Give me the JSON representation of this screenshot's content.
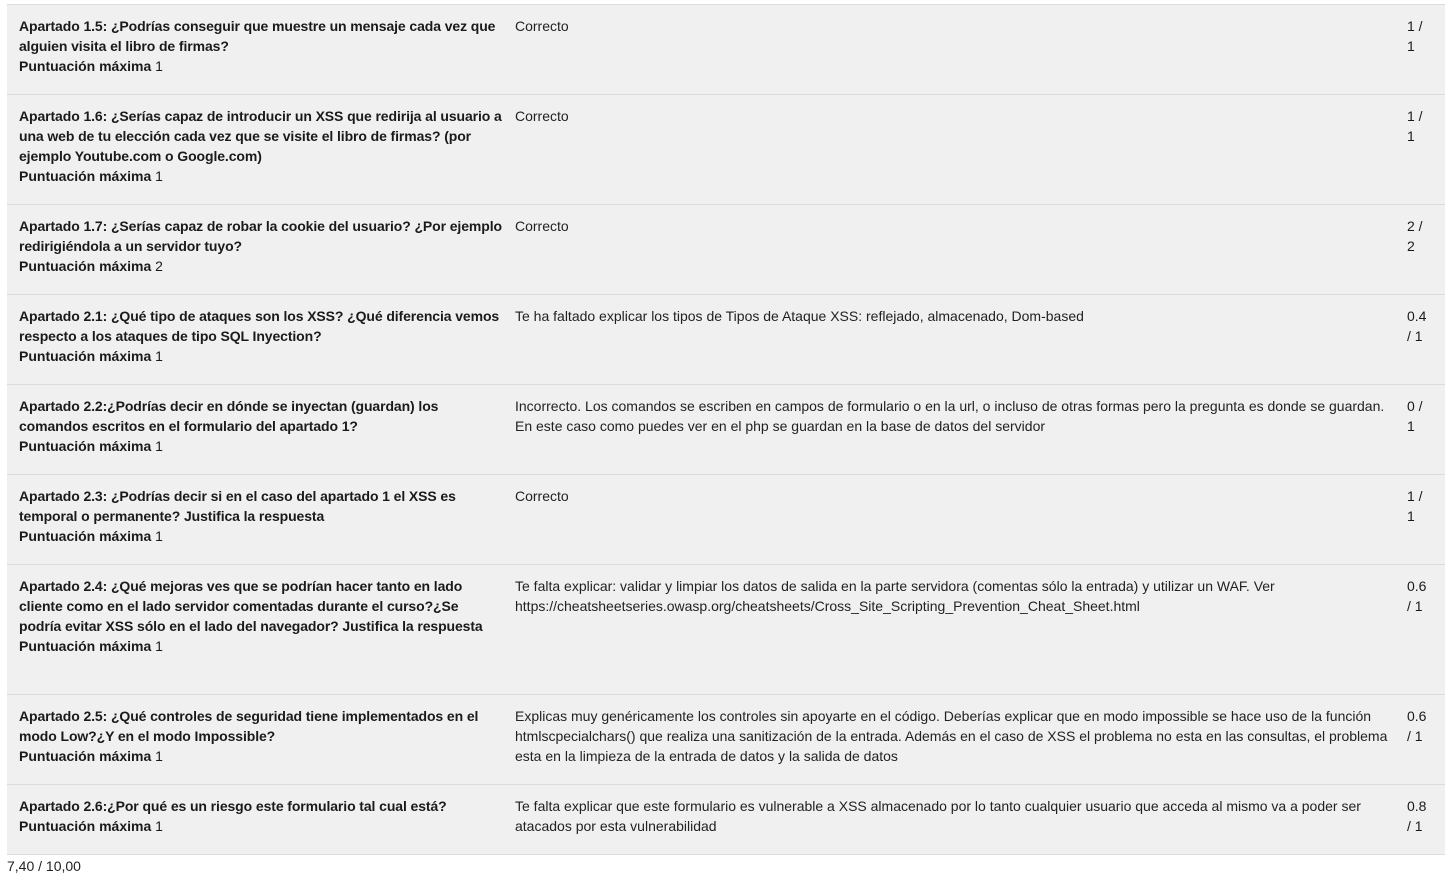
{
  "max_label": "Puntuación máxima",
  "rows": [
    {
      "question": "Apartado 1.5: ¿Podrías conseguir que muestre un mensaje cada vez que alguien visita el libro de firmas?",
      "max": "1",
      "feedback": "Correcto",
      "score": "1 / 1"
    },
    {
      "question": "Apartado 1.6: ¿Serías capaz de introducir un XSS que redirija al usuario a una web de tu elección cada vez que se visite el libro de firmas? (por ejemplo Youtube.com o Google.com)",
      "max": "1",
      "feedback": "Correcto",
      "score": "1 / 1"
    },
    {
      "question": "Apartado 1.7: ¿Serías capaz de robar la cookie del usuario? ¿Por ejemplo redirigiéndola a un servidor tuyo?",
      "max": "2",
      "feedback": "Correcto",
      "score": "2 / 2"
    },
    {
      "question": "Apartado 2.1: ¿Qué tipo de ataques son los XSS? ¿Qué diferencia vemos respecto a los ataques de tipo SQL Inyection?",
      "max": "1",
      "feedback": "Te ha faltado explicar los tipos de Tipos de Ataque XSS: reflejado, almacenado, Dom-based",
      "score": "0.4 / 1"
    },
    {
      "question": "Apartado 2.2:¿Podrías decir en dónde se inyectan (guardan) los comandos escritos en el formulario del apartado 1?",
      "max": "1",
      "feedback": "Incorrecto. Los comandos se escriben en campos de formulario o en la url, o incluso de otras formas pero la pregunta es donde se guardan. En este caso como puedes ver en el php se guardan en la base de datos del servidor",
      "score": "0 / 1"
    },
    {
      "question": "Apartado 2.3: ¿Podrías decir si en el caso del apartado 1 el XSS es temporal o permanente? Justifica la respuesta",
      "max": "1",
      "feedback": "Correcto",
      "score": "1 / 1"
    },
    {
      "question": "Apartado 2.4: ¿Qué mejoras ves que se podrían hacer tanto en lado cliente como en el lado servidor comentadas durante el curso?¿Se podría evitar XSS sólo en el lado del navegador? Justifica la respuesta",
      "max": "1",
      "feedback": "Te falta explicar: validar y limpiar los datos de salida en la parte servidora (comentas sólo la entrada) y utilizar un WAF. Ver https://cheatsheetseries.owasp.org/cheatsheets/Cross_Site_Scripting_Prevention_Cheat_Sheet.html",
      "score": "0.6 / 1"
    },
    {
      "question": "Apartado 2.5: ¿Qué controles de seguridad tiene implementados en el modo Low?¿Y en el modo Impossible?",
      "max": "1",
      "feedback": "Explicas muy genéricamente los controles sin apoyarte en el código. Deberías explicar que en modo impossible se hace uso de la función htmlscpecialchars() que realiza una sanitización de la entrada. Además en el caso de XSS el problema no esta en las consultas, el problema esta en la limpieza de la entrada de datos y la salida de datos",
      "score": "0.6 / 1"
    },
    {
      "question": "Apartado 2.6:¿Por qué es un riesgo este formulario tal cual está?",
      "max": "1",
      "feedback": "Te falta explicar que este formulario es vulnerable a XSS almacenado por lo tanto cualquier usuario que acceda al mismo va a poder ser atacados por esta vulnerabilidad",
      "score": "0.8 / 1"
    }
  ],
  "total": "7,40 / 10,00"
}
